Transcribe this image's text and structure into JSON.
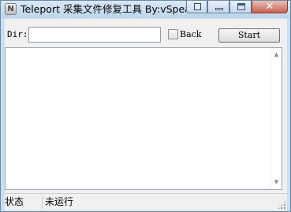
{
  "window": {
    "title": "Teleport 采集文件修复工具 By:vSpear",
    "app_icon_letter": "N",
    "close_glyph": "✕"
  },
  "form": {
    "dir_label": "Dir:",
    "dir_value": "",
    "back_label": "Back",
    "back_checked": false,
    "start_label": "Start"
  },
  "log": {
    "content": "",
    "scroll_up_glyph": "▲",
    "scroll_down_glyph": "▼"
  },
  "status": {
    "label": "状态",
    "value": "未运行"
  },
  "colors": {
    "title_bar": "#c9dff0",
    "close_button": "#c9614d",
    "client_bg": "#f0f0f0"
  }
}
